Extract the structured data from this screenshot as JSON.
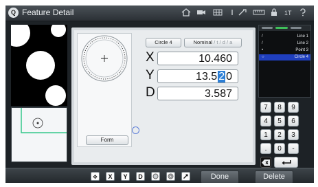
{
  "header": {
    "logo_letter": "Q",
    "title": "Feature Detail",
    "status_text": "1T"
  },
  "measure": {
    "feature_label": "Circle 4",
    "nominal_label": "Nominal",
    "nominal_options": " / t / d / a",
    "form_label": "Form"
  },
  "coords": [
    {
      "label": "X",
      "value": "10.460"
    },
    {
      "label": "Y",
      "value_before": "13.5",
      "value_cursor": "2",
      "value_after": "0"
    },
    {
      "label": "D",
      "value": "3.587"
    }
  ],
  "feature_list": [
    {
      "glyph": "/",
      "name": "Line 1"
    },
    {
      "glyph": "/",
      "name": "Line 2"
    },
    {
      "glyph": "•",
      "name": "Point 3"
    },
    {
      "glyph": "○",
      "name": "Circle 4",
      "selected": true
    }
  ],
  "keypad": {
    "rows": [
      [
        "7",
        "8",
        "9"
      ],
      [
        "4",
        "5",
        "6"
      ],
      [
        "1",
        "2",
        "3"
      ],
      [
        ".",
        "0",
        "-"
      ]
    ]
  },
  "toolbar": {
    "tools": [
      "X",
      "Y",
      "D"
    ],
    "done_label": "Done",
    "delete_label": "Delete"
  },
  "colors": {
    "selection": "#1f3fbf",
    "cursor": "#2c7fd6",
    "tab_active": "#3fbf5a"
  }
}
